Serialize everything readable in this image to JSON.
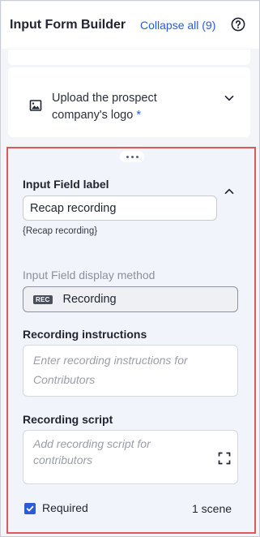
{
  "header": {
    "title": "Input Form Builder",
    "collapse_all": "Collapse all (9)",
    "help_icon": "help-circle-icon"
  },
  "upload_field": {
    "icon": "image-icon",
    "label_line1": "Upload the prospect",
    "label_line2": "company's logo",
    "required_marker": "*"
  },
  "active_field": {
    "input_label_heading": "Input Field label",
    "input_label_value": "Recap recording",
    "token": "{Recap recording}",
    "display_method_heading": "Input Field display method",
    "display_method_badge": "REC",
    "display_method_value": "Recording",
    "instructions_heading": "Recording instructions",
    "instructions_placeholder": "Enter recording instructions for Contributors",
    "script_heading": "Recording script",
    "script_placeholder": "Add recording script for contributors",
    "required_label": "Required",
    "required_checked": true,
    "scene_count": "1 scene"
  },
  "colors": {
    "accent": "#2b5bd7",
    "highlight_border": "#e0575b"
  }
}
